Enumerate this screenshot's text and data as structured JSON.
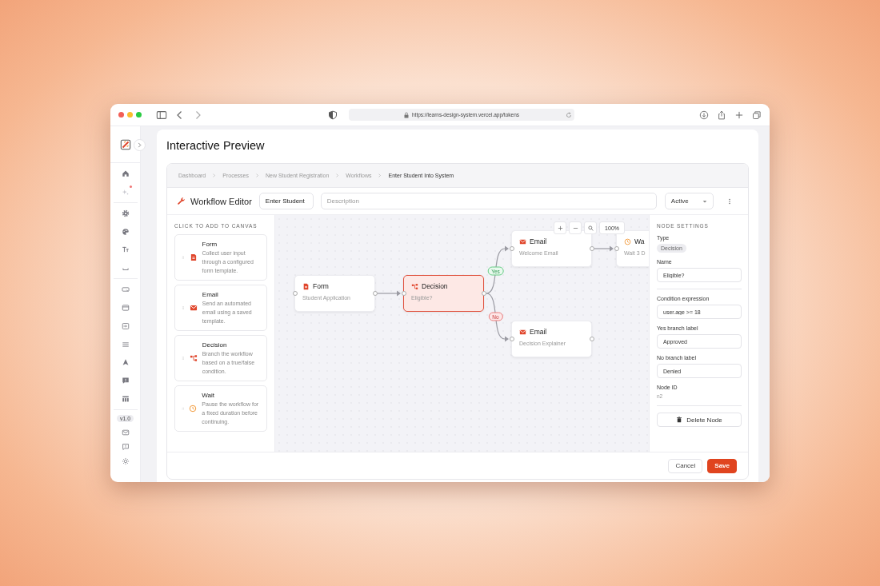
{
  "browser": {
    "url": "https://learns-design-system.vercel.app/tokens"
  },
  "app_sidebar": {
    "version": "v1.0"
  },
  "page_title": "Interactive Preview",
  "breadcrumbs": [
    {
      "label": "Dashboard",
      "selected": false
    },
    {
      "label": "Processes",
      "selected": false
    },
    {
      "label": "New Student Registration",
      "selected": false
    },
    {
      "label": "Workflows",
      "selected": false
    },
    {
      "label": "Enter Student Into System",
      "selected": true
    }
  ],
  "editor": {
    "title": "Workflow Editor",
    "name_field": {
      "value": "Enter Student"
    },
    "description_field": {
      "placeholder": "Description"
    },
    "status_select": {
      "value": "Active"
    }
  },
  "palette": {
    "heading": "CLICK TO ADD TO CANVAS",
    "items": [
      {
        "kind": "form",
        "title": "Form",
        "description": "Collect user input through a configured form template."
      },
      {
        "kind": "email",
        "title": "Email",
        "description": "Send an automated email using a saved template."
      },
      {
        "kind": "decision",
        "title": "Decision",
        "description": "Branch the workflow based on a true/false condition."
      },
      {
        "kind": "wait",
        "title": "Wait",
        "description": "Pause the workflow for a fixed duration before continuing."
      }
    ]
  },
  "canvas": {
    "zoom_level": "100%",
    "nodes": [
      {
        "kind": "form",
        "title": "Form",
        "subtitle": "Student Application",
        "selected": false
      },
      {
        "kind": "decision",
        "title": "Decision",
        "subtitle": "Eligible?",
        "selected": true
      },
      {
        "kind": "email",
        "title": "Email",
        "subtitle": "Welcome Email",
        "selected": false
      },
      {
        "kind": "email",
        "title": "Email",
        "subtitle": "Decision Explainer",
        "selected": false
      },
      {
        "kind": "wait",
        "title": "Wa",
        "subtitle": "Wait 3 D",
        "selected": false
      }
    ],
    "edges": [
      {
        "kind": "plain"
      },
      {
        "kind": "yes",
        "label": "Yes"
      },
      {
        "kind": "no",
        "label": "No"
      },
      {
        "kind": "plain"
      }
    ]
  },
  "settings": {
    "heading": "NODE SETTINGS",
    "fields": [
      {
        "kind": "chip",
        "label": "Type",
        "value": "Decision"
      },
      {
        "kind": "input",
        "label": "Name",
        "value": "Eligible?"
      },
      {
        "kind": "divider"
      },
      {
        "kind": "input",
        "label": "Condition expression",
        "value": "user.age >= 18"
      },
      {
        "kind": "input",
        "label": "Yes branch label",
        "value": "Approved"
      },
      {
        "kind": "input",
        "label": "No branch label",
        "value": "Denied"
      },
      {
        "kind": "text",
        "label": "Node ID",
        "value": "n2"
      },
      {
        "kind": "divider"
      }
    ],
    "delete_button": "Delete Node"
  },
  "footer_buttons": [
    {
      "kind": "secondary",
      "label": "Cancel"
    },
    {
      "kind": "primary",
      "label": "Save"
    }
  ]
}
